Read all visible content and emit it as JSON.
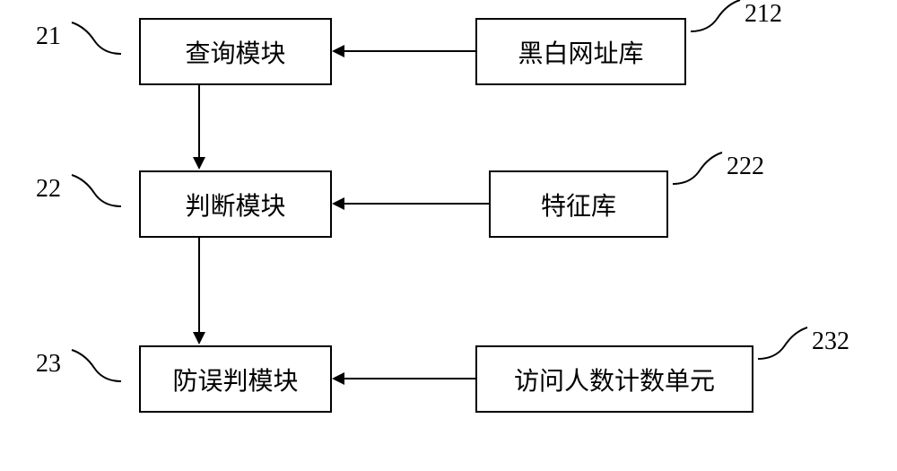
{
  "diagram": {
    "boxes": {
      "query_module": {
        "label": "查询模块",
        "ref": "21"
      },
      "bw_url_db": {
        "label": "黑白网址库",
        "ref": "212"
      },
      "judge_module": {
        "label": "判断模块",
        "ref": "22"
      },
      "feature_db": {
        "label": "特征库",
        "ref": "222"
      },
      "anti_misjudge_module": {
        "label": "防误判模块",
        "ref": "23"
      },
      "visitor_counter": {
        "label": "访问人数计数单元",
        "ref": "232"
      }
    }
  }
}
